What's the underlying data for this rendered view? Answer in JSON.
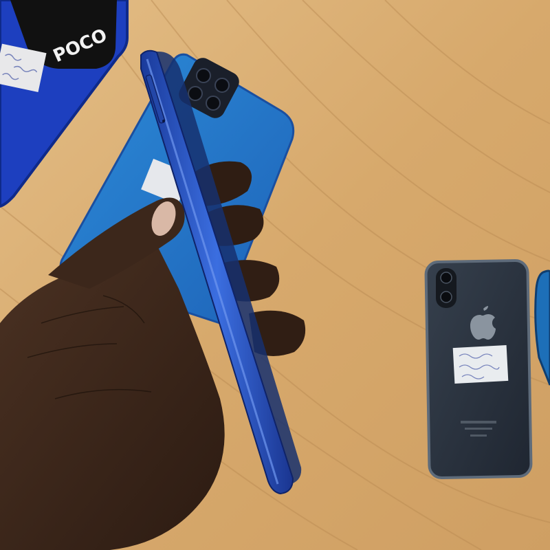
{
  "photo": {
    "poco_brand": "POCO",
    "colors": {
      "table_wood": "#d8ad72",
      "table_grain_dark": "#b98a52",
      "poco_phone_blue": "#1d3fbf",
      "held_phone_blue": "#2a56c9",
      "mid_phone_blue": "#2a7fd0",
      "iphone_dark": "#2c3440",
      "hand_skin": "#3a2519"
    },
    "icons": [
      "apple-logo-icon",
      "camera-module-icon"
    ]
  }
}
